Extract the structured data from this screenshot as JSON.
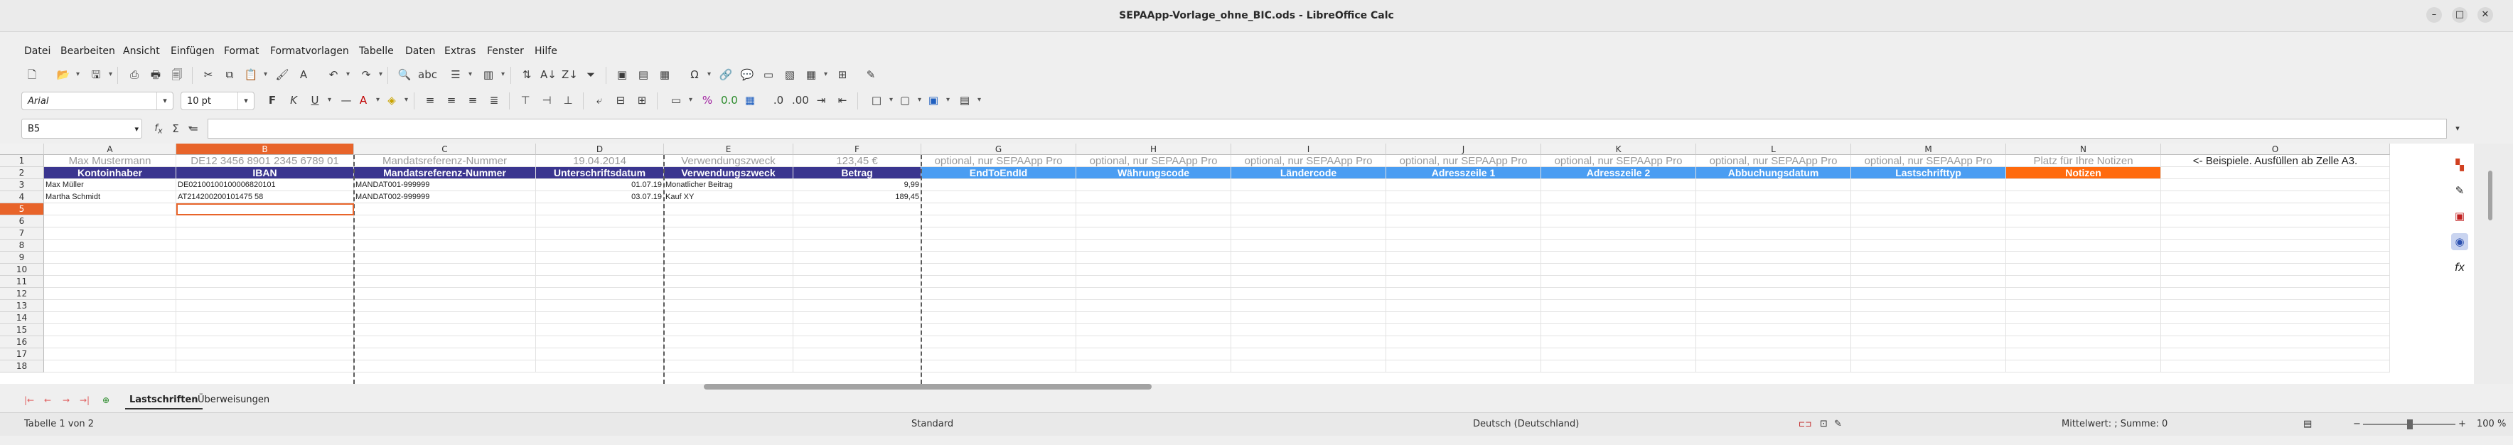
{
  "window": {
    "title": "SEPAApp-Vorlage_ohne_BIC.ods - LibreOffice Calc"
  },
  "menu": [
    "Datei",
    "Bearbeiten",
    "Ansicht",
    "Einfügen",
    "Format",
    "Formatvorlagen",
    "Tabelle",
    "Daten",
    "Extras",
    "Fenster",
    "Hilfe"
  ],
  "font": {
    "name": "Arial",
    "size": "10 pt"
  },
  "namebox": "B5",
  "formula": {
    "fx": "f",
    "sum": "Σ",
    "eq": "="
  },
  "columns": [
    "A",
    "B",
    "C",
    "D",
    "E",
    "F",
    "G",
    "H",
    "I",
    "J",
    "K",
    "L",
    "M",
    "N",
    "O"
  ],
  "rows": [
    "1",
    "2",
    "3",
    "4",
    "5",
    "6",
    "7",
    "8",
    "9",
    "10",
    "11",
    "12",
    "13",
    "14",
    "15",
    "16",
    "17",
    "18"
  ],
  "row1": [
    "Max Mustermann",
    "DE12 3456 8901 2345 6789 01",
    "Mandatsreferenz-Nummer",
    "19.04.2014",
    "Verwendungszweck",
    "123,45 €",
    "optional, nur SEPAApp Pro",
    "optional, nur SEPAApp Pro",
    "optional, nur SEPAApp Pro",
    "optional, nur SEPAApp Pro",
    "optional, nur SEPAApp Pro",
    "optional, nur SEPAApp Pro",
    "optional, nur SEPAApp Pro",
    "Platz für Ihre Notizen",
    "<- Beispiele. Ausfüllen ab Zelle A3."
  ],
  "row2": [
    "Kontoinhaber",
    "IBAN",
    "Mandatsreferenz-Nummer",
    "Unterschriftsdatum",
    "Verwendungszweck",
    "Betrag",
    "EndToEndId",
    "Währungscode",
    "Ländercode",
    "Adresszeile 1",
    "Adresszeile 2",
    "Abbuchungsdatum",
    "Lastschrifttyp",
    "Notizen",
    ""
  ],
  "data_rows": [
    {
      "A": "Max Müller",
      "B": "DE02100100100006820101",
      "C": "MANDAT001-999999",
      "D": "01.07.19",
      "E": "Monatlicher Beitrag",
      "F": "9,99"
    },
    {
      "A": "Martha Schmidt",
      "B": "AT214200200101475 58",
      "C": "MANDAT002-999999",
      "D": "03.07.19",
      "E": "Kauf XY",
      "F": "189,45"
    }
  ],
  "colors": {
    "header_dark": "#3a358f",
    "header_light": "#4a9df2",
    "header_notes": "#ff6a0d",
    "selection": "#e8642a"
  },
  "sheets": [
    "Lastschriften",
    "Überweisungen"
  ],
  "status": {
    "sheet": "Tabelle 1 von 2",
    "style": "Standard",
    "language": "Deutsch (Deutschland)",
    "summary": "Mittelwert: ; Summe: 0",
    "zoom": "100 %"
  }
}
